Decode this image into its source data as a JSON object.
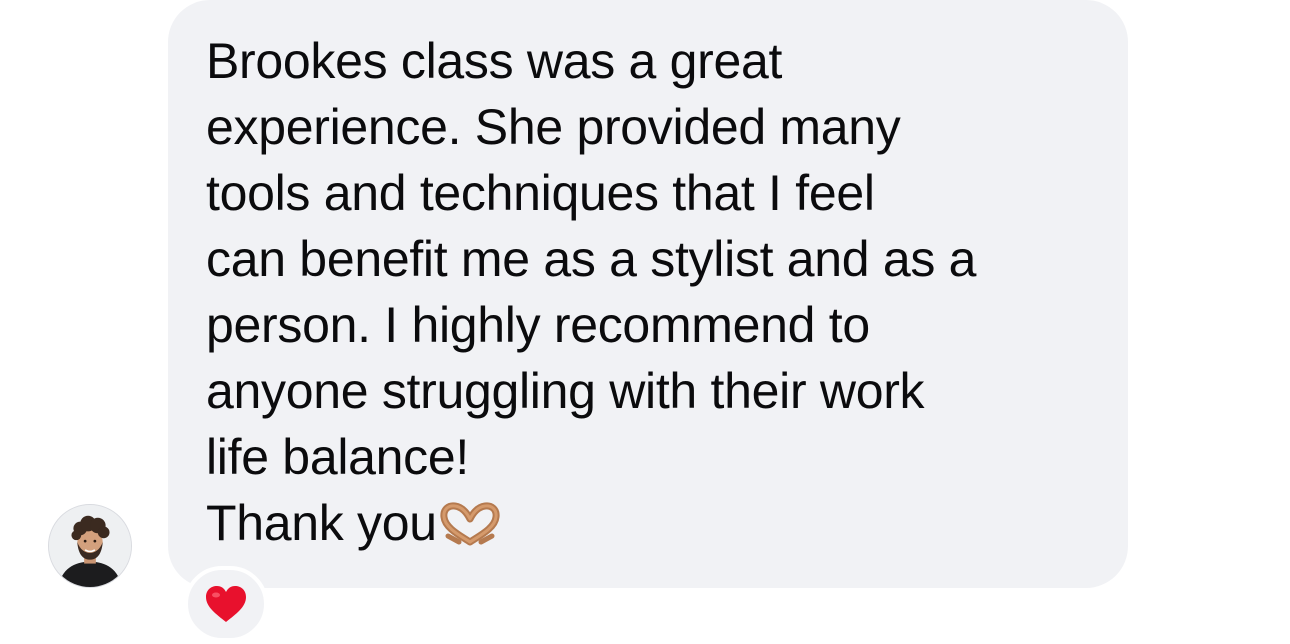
{
  "message": {
    "lines": [
      "Brookes class was a great",
      "experience. She provided many",
      "tools and techniques that I feel",
      "can benefit me as a stylist and as a",
      "person. I highly recommend to",
      "anyone struggling with their work",
      "life balance!",
      "Thank you"
    ],
    "trailing_emoji": "heart-hands-icon"
  },
  "reaction": {
    "emoji": "heart-icon",
    "color": "#e8112d"
  },
  "colors": {
    "bubble": "#f1f2f5",
    "text": "#0b0b0d",
    "background": "#ffffff"
  }
}
